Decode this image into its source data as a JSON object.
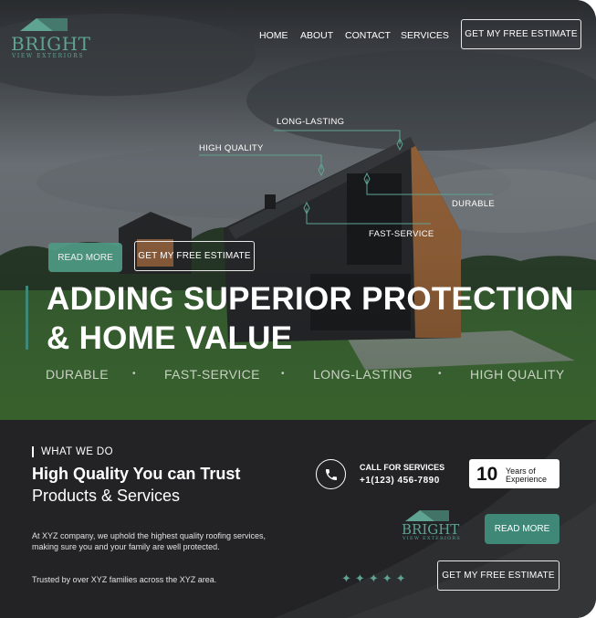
{
  "brand": {
    "name": "BRIGHT",
    "tagline": "VIEW EXTERIORS",
    "color": "#5fa392"
  },
  "nav": {
    "home": "HOME",
    "about": "ABOUT",
    "contact": "CONTACT",
    "services": "SERVICES"
  },
  "hero": {
    "cta_estimate": "GET MY FREE ESTIMATE",
    "read_more": "READ MORE",
    "annotations": {
      "long_lasting": "LONG-LASTING",
      "high_quality": "HIGH QUALITY",
      "durable": "DURABLE",
      "fast_service": "FAST-SERVICE"
    },
    "headline_line1": "ADDING SUPERIOR PROTECTION",
    "headline_line2": "& HOME VALUE",
    "features": [
      "DURABLE",
      "FAST-SERVICE",
      "LONG-LASTING",
      "HIGH QUALITY"
    ],
    "accent": "#3f8777"
  },
  "about": {
    "kicker": "WHAT WE DO",
    "title_bold": "High Quality You can Trust",
    "title_regular": "Products & Services",
    "paragraph": "At XYZ company, we uphold the highest quality roofing services, making sure you and your family are well protected.",
    "trust_line": "Trusted by over XYZ families across the XYZ area.",
    "call_label": "CALL FOR SERVICES",
    "phone": "+1(123) 456-7890",
    "years_number": "10",
    "years_line1": "Years of",
    "years_line2": "Experience",
    "read_more": "READ MORE",
    "cta_estimate": "GET MY FREE ESTIMATE",
    "star_count": 5
  },
  "icons": [
    "house-roof-icon",
    "phone-icon",
    "sparkle-icon"
  ]
}
